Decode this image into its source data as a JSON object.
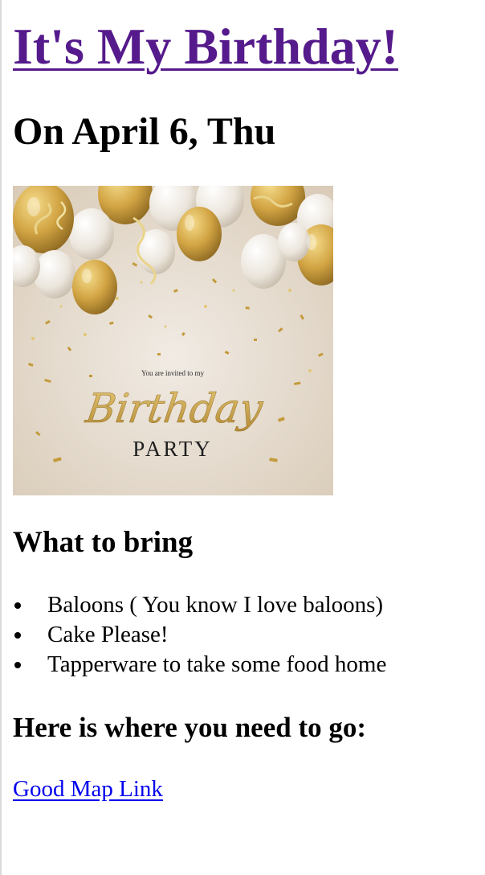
{
  "header": {
    "title": "It's My Birthday!",
    "date": "On April 6, Thu"
  },
  "invite_image": {
    "small_text": "You are invited to my",
    "script_text": "Birthday",
    "caps_text": "PARTY",
    "colors": {
      "background": "#e6dccf",
      "gold": "#c9a24a",
      "pearl": "#eeeae3"
    }
  },
  "bring": {
    "heading": "What to bring",
    "items": [
      "Baloons ( You know I love baloons)",
      "Cake Please!",
      "Tapperware to take some food home"
    ]
  },
  "directions": {
    "heading": "Here is where you need to go:",
    "map_link": "Good Map Link"
  },
  "colors": {
    "visited_link": "#551a8b",
    "link": "#0000ee"
  }
}
